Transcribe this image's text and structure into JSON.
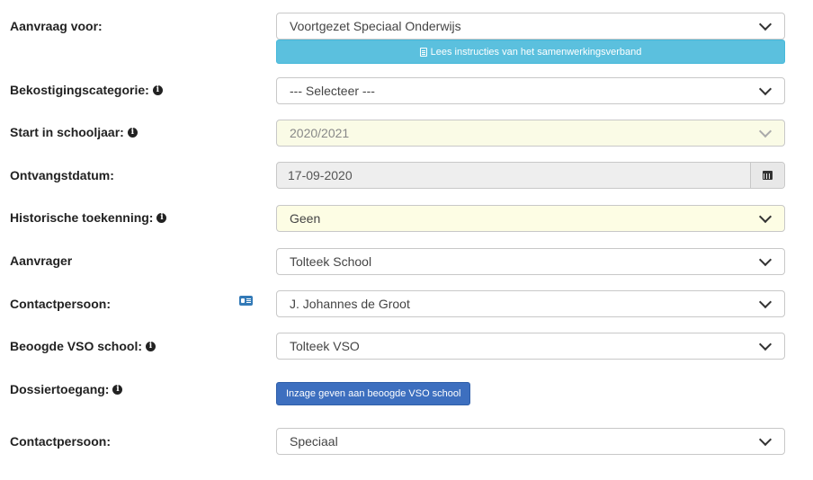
{
  "fields": {
    "aanvraag_voor": {
      "label": "Aanvraag voor:",
      "value": "Voortgezet Speciaal Onderwijs"
    },
    "instructions_button": "Lees instructies van het samenwerkingsverband",
    "bekostigingscategorie": {
      "label": "Bekostigingscategorie:",
      "value": "--- Selecteer ---"
    },
    "start_schooljaar": {
      "label": "Start in schooljaar:",
      "value": "2020/2021"
    },
    "ontvangstdatum": {
      "label": "Ontvangstdatum:",
      "value": "17-09-2020"
    },
    "historische_toekenning": {
      "label": "Historische toekenning:",
      "value": "Geen"
    },
    "aanvrager": {
      "label": "Aanvrager",
      "value": "Tolteek School"
    },
    "contactpersoon_1": {
      "label": "Contactpersoon:",
      "value": "J. Johannes de Groot"
    },
    "beoogde_vso_school": {
      "label": "Beoogde VSO school:",
      "value": "Tolteek VSO"
    },
    "dossiertoegang": {
      "label": "Dossiertoegang:",
      "button": "Inzage geven aan beoogde VSO school"
    },
    "contactpersoon_2": {
      "label": "Contactpersoon:",
      "value": "Speciaal"
    }
  },
  "icons": {
    "info": "info-circle-icon",
    "instructions": "list-alt-icon",
    "calendar": "calendar-icon",
    "contact_card": "address-card-icon"
  },
  "colors": {
    "info_button": "#5bc0de",
    "primary_button": "#3d6fbf",
    "highlight_field": "#fdfde4",
    "contact_card_icon": "#337ab7"
  }
}
